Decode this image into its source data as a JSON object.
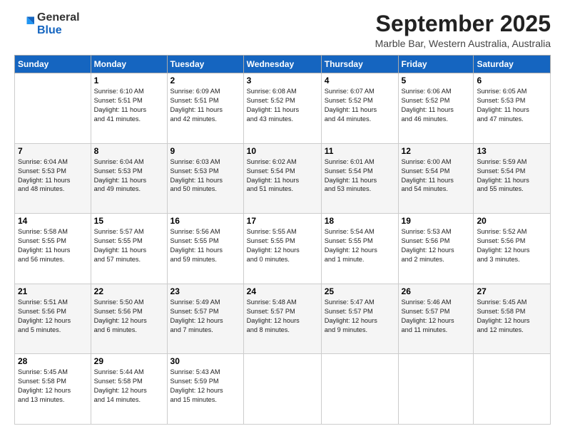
{
  "header": {
    "logo_general": "General",
    "logo_blue": "Blue",
    "month_title": "September 2025",
    "subtitle": "Marble Bar, Western Australia, Australia"
  },
  "days_of_week": [
    "Sunday",
    "Monday",
    "Tuesday",
    "Wednesday",
    "Thursday",
    "Friday",
    "Saturday"
  ],
  "weeks": [
    [
      {
        "day": "",
        "info": ""
      },
      {
        "day": "1",
        "info": "Sunrise: 6:10 AM\nSunset: 5:51 PM\nDaylight: 11 hours\nand 41 minutes."
      },
      {
        "day": "2",
        "info": "Sunrise: 6:09 AM\nSunset: 5:51 PM\nDaylight: 11 hours\nand 42 minutes."
      },
      {
        "day": "3",
        "info": "Sunrise: 6:08 AM\nSunset: 5:52 PM\nDaylight: 11 hours\nand 43 minutes."
      },
      {
        "day": "4",
        "info": "Sunrise: 6:07 AM\nSunset: 5:52 PM\nDaylight: 11 hours\nand 44 minutes."
      },
      {
        "day": "5",
        "info": "Sunrise: 6:06 AM\nSunset: 5:52 PM\nDaylight: 11 hours\nand 46 minutes."
      },
      {
        "day": "6",
        "info": "Sunrise: 6:05 AM\nSunset: 5:53 PM\nDaylight: 11 hours\nand 47 minutes."
      }
    ],
    [
      {
        "day": "7",
        "info": "Sunrise: 6:04 AM\nSunset: 5:53 PM\nDaylight: 11 hours\nand 48 minutes."
      },
      {
        "day": "8",
        "info": "Sunrise: 6:04 AM\nSunset: 5:53 PM\nDaylight: 11 hours\nand 49 minutes."
      },
      {
        "day": "9",
        "info": "Sunrise: 6:03 AM\nSunset: 5:53 PM\nDaylight: 11 hours\nand 50 minutes."
      },
      {
        "day": "10",
        "info": "Sunrise: 6:02 AM\nSunset: 5:54 PM\nDaylight: 11 hours\nand 51 minutes."
      },
      {
        "day": "11",
        "info": "Sunrise: 6:01 AM\nSunset: 5:54 PM\nDaylight: 11 hours\nand 53 minutes."
      },
      {
        "day": "12",
        "info": "Sunrise: 6:00 AM\nSunset: 5:54 PM\nDaylight: 11 hours\nand 54 minutes."
      },
      {
        "day": "13",
        "info": "Sunrise: 5:59 AM\nSunset: 5:54 PM\nDaylight: 11 hours\nand 55 minutes."
      }
    ],
    [
      {
        "day": "14",
        "info": "Sunrise: 5:58 AM\nSunset: 5:55 PM\nDaylight: 11 hours\nand 56 minutes."
      },
      {
        "day": "15",
        "info": "Sunrise: 5:57 AM\nSunset: 5:55 PM\nDaylight: 11 hours\nand 57 minutes."
      },
      {
        "day": "16",
        "info": "Sunrise: 5:56 AM\nSunset: 5:55 PM\nDaylight: 11 hours\nand 59 minutes."
      },
      {
        "day": "17",
        "info": "Sunrise: 5:55 AM\nSunset: 5:55 PM\nDaylight: 12 hours\nand 0 minutes."
      },
      {
        "day": "18",
        "info": "Sunrise: 5:54 AM\nSunset: 5:55 PM\nDaylight: 12 hours\nand 1 minute."
      },
      {
        "day": "19",
        "info": "Sunrise: 5:53 AM\nSunset: 5:56 PM\nDaylight: 12 hours\nand 2 minutes."
      },
      {
        "day": "20",
        "info": "Sunrise: 5:52 AM\nSunset: 5:56 PM\nDaylight: 12 hours\nand 3 minutes."
      }
    ],
    [
      {
        "day": "21",
        "info": "Sunrise: 5:51 AM\nSunset: 5:56 PM\nDaylight: 12 hours\nand 5 minutes."
      },
      {
        "day": "22",
        "info": "Sunrise: 5:50 AM\nSunset: 5:56 PM\nDaylight: 12 hours\nand 6 minutes."
      },
      {
        "day": "23",
        "info": "Sunrise: 5:49 AM\nSunset: 5:57 PM\nDaylight: 12 hours\nand 7 minutes."
      },
      {
        "day": "24",
        "info": "Sunrise: 5:48 AM\nSunset: 5:57 PM\nDaylight: 12 hours\nand 8 minutes."
      },
      {
        "day": "25",
        "info": "Sunrise: 5:47 AM\nSunset: 5:57 PM\nDaylight: 12 hours\nand 9 minutes."
      },
      {
        "day": "26",
        "info": "Sunrise: 5:46 AM\nSunset: 5:57 PM\nDaylight: 12 hours\nand 11 minutes."
      },
      {
        "day": "27",
        "info": "Sunrise: 5:45 AM\nSunset: 5:58 PM\nDaylight: 12 hours\nand 12 minutes."
      }
    ],
    [
      {
        "day": "28",
        "info": "Sunrise: 5:45 AM\nSunset: 5:58 PM\nDaylight: 12 hours\nand 13 minutes."
      },
      {
        "day": "29",
        "info": "Sunrise: 5:44 AM\nSunset: 5:58 PM\nDaylight: 12 hours\nand 14 minutes."
      },
      {
        "day": "30",
        "info": "Sunrise: 5:43 AM\nSunset: 5:59 PM\nDaylight: 12 hours\nand 15 minutes."
      },
      {
        "day": "",
        "info": ""
      },
      {
        "day": "",
        "info": ""
      },
      {
        "day": "",
        "info": ""
      },
      {
        "day": "",
        "info": ""
      }
    ]
  ]
}
